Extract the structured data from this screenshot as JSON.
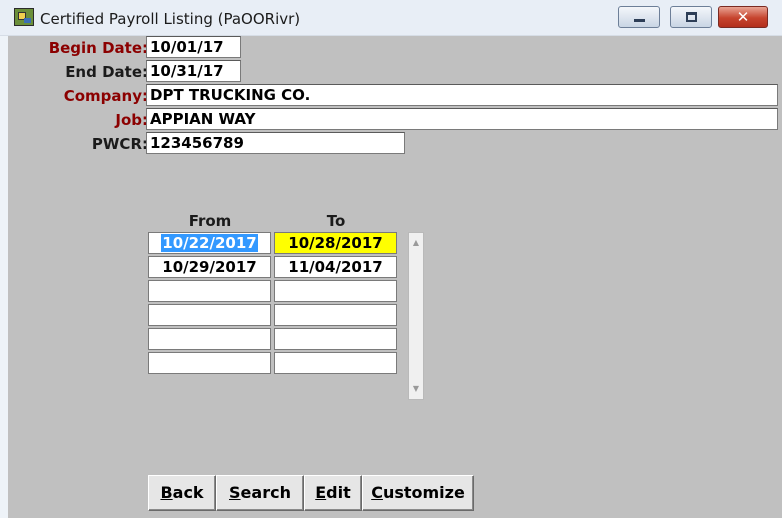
{
  "window": {
    "title": "Certified Payroll Listing (PaOORivr)",
    "close_symbol": "✕",
    "icons": {
      "app": "payroll-app-icon",
      "minimize": "minimize-icon",
      "maximize": "maximize-icon",
      "close": "close-icon"
    }
  },
  "form": {
    "begin_date": {
      "label": "Begin Date:",
      "value": "10/01/17"
    },
    "end_date": {
      "label": "End Date:",
      "value": "10/31/17"
    },
    "company": {
      "label": "Company:",
      "value": "DPT TRUCKING CO."
    },
    "job": {
      "label": "Job:",
      "value": "APPIAN WAY"
    },
    "pwcr": {
      "label": "PWCR:",
      "value": "123456789"
    }
  },
  "periods": {
    "headers": {
      "from": "From",
      "to": "To"
    },
    "rows": [
      {
        "from": "10/22/2017",
        "to": "10/28/2017"
      },
      {
        "from": "10/29/2017",
        "to": "11/04/2017"
      },
      {
        "from": "",
        "to": ""
      },
      {
        "from": "",
        "to": ""
      },
      {
        "from": "",
        "to": ""
      },
      {
        "from": "",
        "to": ""
      }
    ],
    "selected_row": 0,
    "scroll_up_symbol": "▲",
    "scroll_down_symbol": "▼"
  },
  "buttons": {
    "back": {
      "mnemonic": "B",
      "rest": "ack"
    },
    "search": {
      "mnemonic": "S",
      "rest": "earch"
    },
    "edit": {
      "mnemonic": "E",
      "rest": "dit"
    },
    "customize": {
      "mnemonic": "C",
      "rest": "ustomize"
    }
  },
  "colors": {
    "required_label": "#8b0000",
    "selection_highlight": "#3399ff",
    "to_highlight": "#ffff00",
    "client_background": "#c0c0c0"
  }
}
